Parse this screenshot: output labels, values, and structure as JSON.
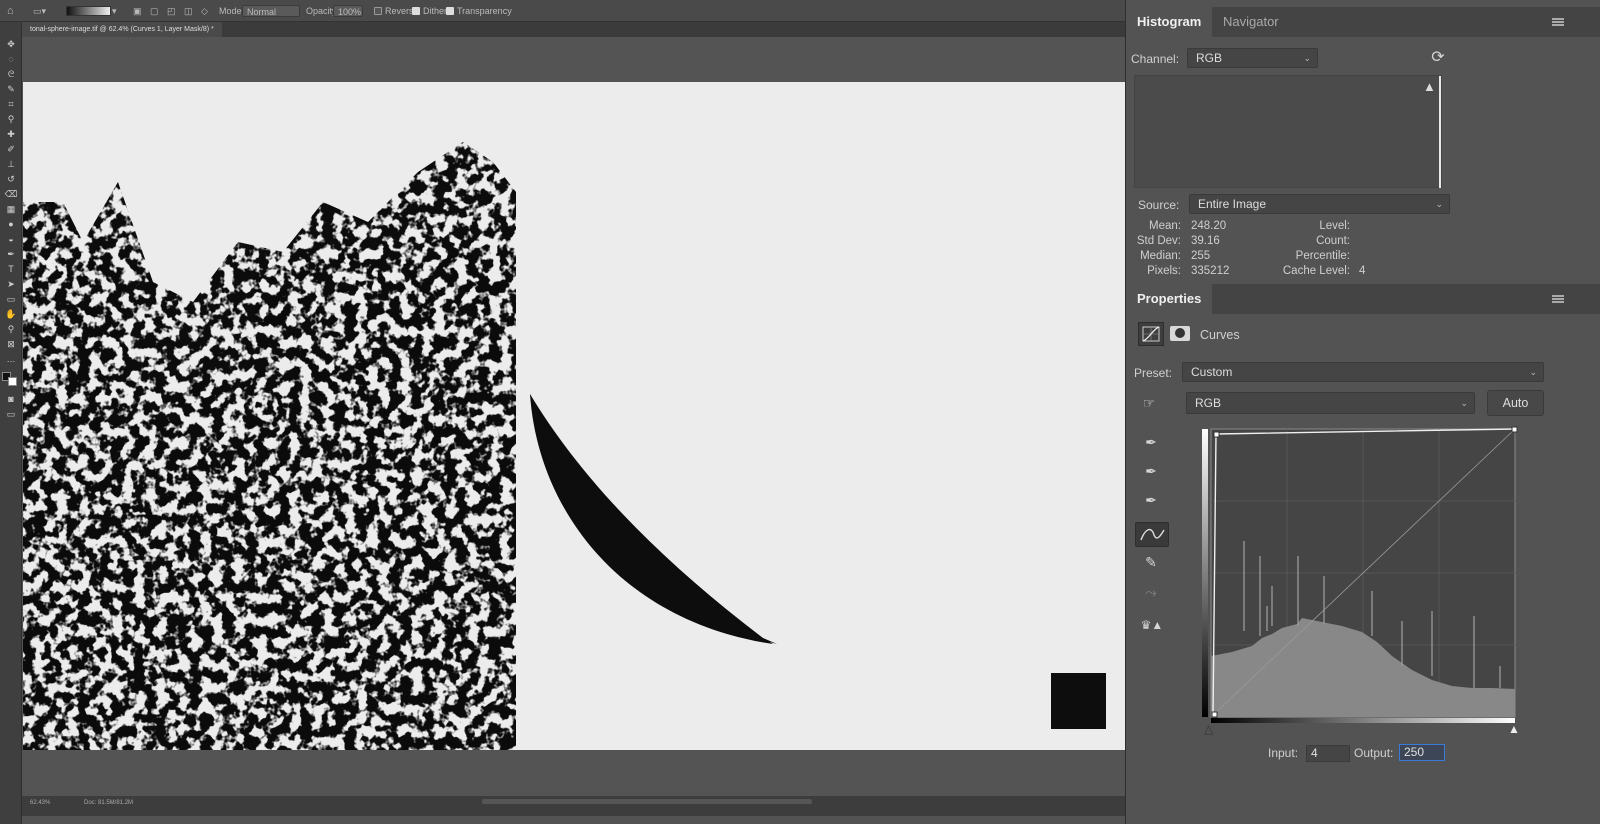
{
  "options_bar": {
    "mode_label": "Mode:",
    "mode_value": "Normal",
    "opacity_label": "Opacity:",
    "opacity_value": "100%",
    "reverse_label": "Reverse",
    "dither_label": "Dither",
    "transparency_label": "Transparency"
  },
  "document": {
    "tab_title": "tonal-sphere-image.tif @ 62.4% (Curves 1, Layer Mask/8) *",
    "zoom": "62.43%",
    "doc_size": "Doc: 81.5M/81.2M"
  },
  "histogram_panel": {
    "tabs": [
      "Histogram",
      "Navigator"
    ],
    "channel_label": "Channel:",
    "channel_value": "RGB",
    "source_label": "Source:",
    "source_value": "Entire Image",
    "stats_left": [
      {
        "label": "Mean:",
        "value": "248.20"
      },
      {
        "label": "Std Dev:",
        "value": "39.16"
      },
      {
        "label": "Median:",
        "value": "255"
      },
      {
        "label": "Pixels:",
        "value": "335212"
      }
    ],
    "stats_right": [
      {
        "label": "Level:",
        "value": ""
      },
      {
        "label": "Count:",
        "value": ""
      },
      {
        "label": "Percentile:",
        "value": ""
      },
      {
        "label": "Cache Level:",
        "value": "4"
      }
    ]
  },
  "properties_panel": {
    "title": "Properties",
    "adjustment_name": "Curves",
    "preset_label": "Preset:",
    "preset_value": "Custom",
    "channel_value": "RGB",
    "auto_label": "Auto",
    "input_label": "Input:",
    "input_value": "4",
    "output_label": "Output:",
    "output_value": "250"
  },
  "colors": {
    "panel_bg": "#535353",
    "canvas_bg": "#ececec",
    "dark_tab": "#444444"
  }
}
